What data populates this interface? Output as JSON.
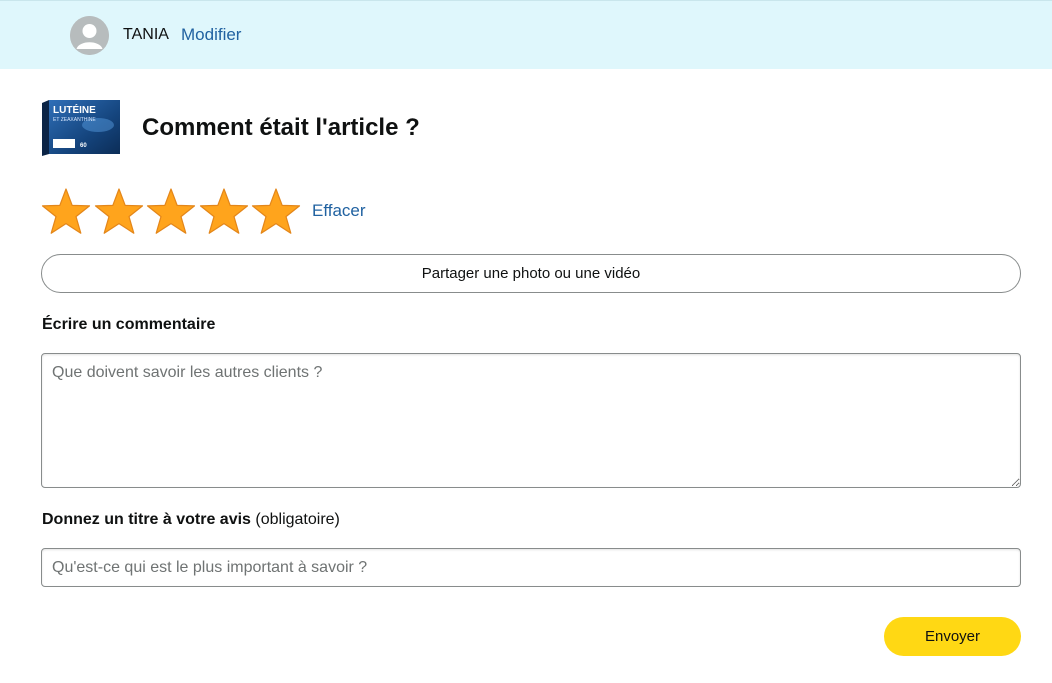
{
  "user": {
    "name": "TANIA",
    "edit_label": "Modifier"
  },
  "product": {
    "image_brand": "LUTÉINE",
    "image_sub": "ET ZEAXANTHINE",
    "image_count": "60"
  },
  "page_title": "Comment était l'article ?",
  "rating": {
    "value": 5,
    "max": 5,
    "clear_label": "Effacer"
  },
  "share_button_label": "Partager une photo ou une vidéo",
  "comment": {
    "label": "Écrire un commentaire",
    "placeholder": "Que doivent savoir les autres clients ?"
  },
  "review_title": {
    "label": "Donnez un titre à votre avis",
    "required_note": "(obligatoire)",
    "placeholder": "Qu'est-ce qui est le plus important à savoir ?"
  },
  "submit_label": "Envoyer",
  "colors": {
    "header_bg": "#dff7fc",
    "link": "#2162a1",
    "star": "#ffa41c",
    "submit_bg": "#ffd814"
  }
}
